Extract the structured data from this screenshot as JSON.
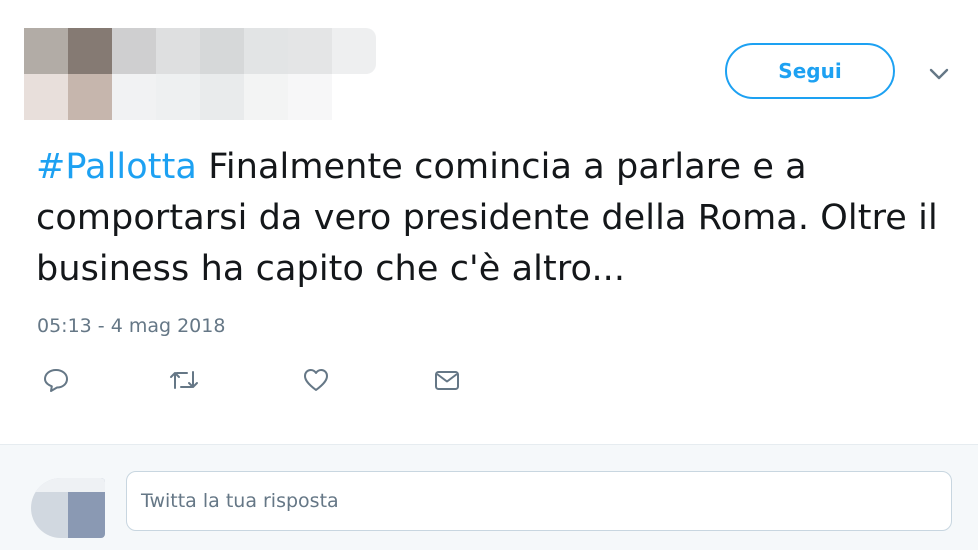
{
  "header": {
    "follow_label": "Segui",
    "caret_icon": "chevron-down-icon"
  },
  "tweet": {
    "hashtag": "#Pallotta",
    "text": " Finalmente comincia a parlare e a comportarsi da vero presidente della Roma. Oltre il business ha capito che c'è altro...",
    "timestamp": "05:13 - 4 mag 2018"
  },
  "actions": [
    {
      "icon": "reply-icon"
    },
    {
      "icon": "retweet-icon"
    },
    {
      "icon": "like-heart-icon"
    },
    {
      "icon": "direct-message-icon"
    }
  ],
  "reply": {
    "placeholder": "Twitta la tua risposta"
  },
  "colors": {
    "accent": "#1da1f2",
    "text": "#14171a",
    "muted": "#657786",
    "reply_bg": "#f5f8fa"
  }
}
